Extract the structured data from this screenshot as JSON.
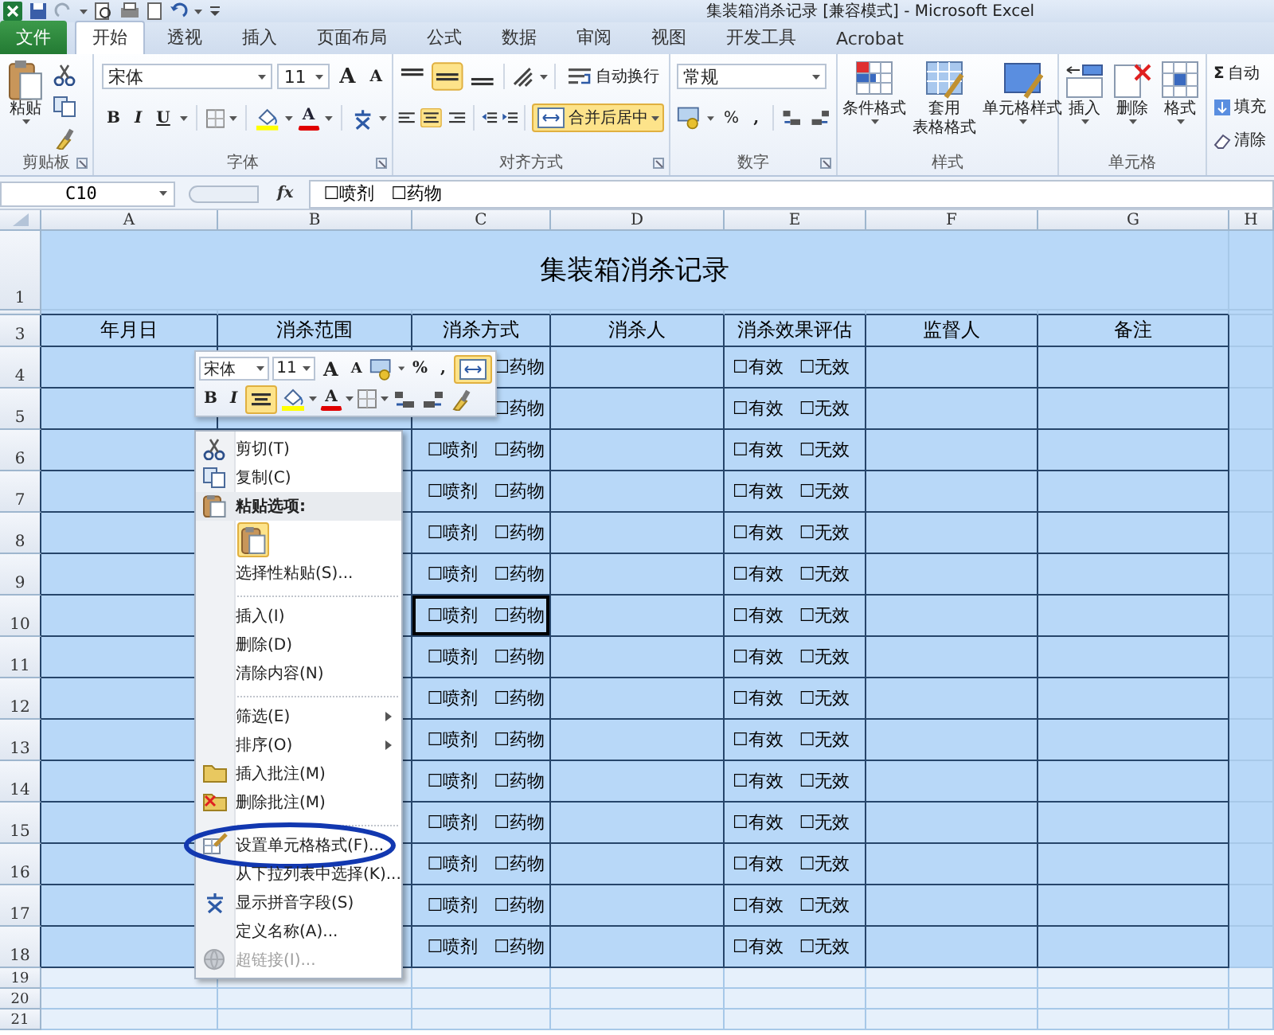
{
  "window": {
    "title": "集装箱消杀记录  [兼容模式] - Microsoft Excel"
  },
  "tabs": [
    {
      "label": "文件",
      "kind": "file",
      "selected": false
    },
    {
      "label": "开始",
      "kind": "tab",
      "selected": true
    },
    {
      "label": "透视",
      "kind": "tab",
      "selected": false
    },
    {
      "label": "插入",
      "kind": "tab",
      "selected": false
    },
    {
      "label": "页面布局",
      "kind": "tab",
      "selected": false
    },
    {
      "label": "公式",
      "kind": "tab",
      "selected": false
    },
    {
      "label": "数据",
      "kind": "tab",
      "selected": false
    },
    {
      "label": "审阅",
      "kind": "tab",
      "selected": false
    },
    {
      "label": "视图",
      "kind": "tab",
      "selected": false
    },
    {
      "label": "开发工具",
      "kind": "tab",
      "selected": false
    },
    {
      "label": "Acrobat",
      "kind": "tab",
      "selected": false
    }
  ],
  "ribbon": {
    "clipboard": {
      "label": "剪贴板",
      "paste": "粘贴"
    },
    "font": {
      "label": "字体",
      "name": "宋体",
      "size": "11",
      "grow": "A",
      "shrink": "A",
      "bold": "B",
      "italic": "I",
      "underline": "U",
      "color_letter": "A"
    },
    "alignment": {
      "label": "对齐方式",
      "vertical": [
        {
          "selected": false
        },
        {
          "selected": true
        },
        {
          "selected": false
        }
      ],
      "horizontal": [
        {
          "selected": false
        },
        {
          "selected": true
        },
        {
          "selected": false
        }
      ],
      "wrap": {
        "label": "自动换行",
        "on": false
      },
      "merge": {
        "label": "合并后居中",
        "on": true
      }
    },
    "number": {
      "label": "数字",
      "format": "常规",
      "percent": "%",
      "comma": ","
    },
    "styles": {
      "label": "样式",
      "conditional": "条件格式",
      "table": [
        "套用",
        "表格格式"
      ],
      "cell": "单元格样式"
    },
    "cells": {
      "label": "单元格",
      "insert": "插入",
      "delete": "删除",
      "format": "格式"
    },
    "editing": {
      "sigma": "Σ",
      "autosum": "自动",
      "fill": "填充",
      "clear": "清除"
    }
  },
  "formula_bar": {
    "name_box": "C10",
    "fx": "fx",
    "content": "☐喷剂   ☐药物"
  },
  "sheet": {
    "columns": [
      "A",
      "B",
      "C",
      "D",
      "E",
      "F",
      "G",
      "H"
    ],
    "title": {
      "row": "1",
      "text": "集装箱消杀记录"
    },
    "header_row": {
      "row": "3",
      "cells": [
        "年月日",
        "消杀范围",
        "消杀方式",
        "消杀人",
        "消杀效果评估",
        "监督人",
        "备注"
      ]
    },
    "rows": [
      {
        "row": "4",
        "method": [
          "☐药物"
        ],
        "evaluation": [
          "☐有效",
          "☐无效"
        ],
        "selected": false
      },
      {
        "row": "5",
        "method": [
          "☐药物"
        ],
        "evaluation": [
          "☐有效",
          "☐无效"
        ],
        "selected": false
      },
      {
        "row": "6",
        "method": [
          "☐喷剂",
          "☐药物"
        ],
        "evaluation": [
          "☐有效",
          "☐无效"
        ],
        "selected": false
      },
      {
        "row": "7",
        "method": [
          "☐喷剂",
          "☐药物"
        ],
        "evaluation": [
          "☐有效",
          "☐无效"
        ],
        "selected": false
      },
      {
        "row": "8",
        "method": [
          "☐喷剂",
          "☐药物"
        ],
        "evaluation": [
          "☐有效",
          "☐无效"
        ],
        "selected": false
      },
      {
        "row": "9",
        "method": [
          "☐喷剂",
          "☐药物"
        ],
        "evaluation": [
          "☐有效",
          "☐无效"
        ],
        "selected": false
      },
      {
        "row": "10",
        "method": [
          "☐喷剂",
          "☐药物"
        ],
        "evaluation": [
          "☐有效",
          "☐无效"
        ],
        "selected": true
      },
      {
        "row": "11",
        "method": [
          "☐喷剂",
          "☐药物"
        ],
        "evaluation": [
          "☐有效",
          "☐无效"
        ],
        "selected": false
      },
      {
        "row": "12",
        "method": [
          "☐喷剂",
          "☐药物"
        ],
        "evaluation": [
          "☐有效",
          "☐无效"
        ],
        "selected": false
      },
      {
        "row": "13",
        "method": [
          "☐喷剂",
          "☐药物"
        ],
        "evaluation": [
          "☐有效",
          "☐无效"
        ],
        "selected": false
      },
      {
        "row": "14",
        "method": [
          "☐喷剂",
          "☐药物"
        ],
        "evaluation": [
          "☐有效",
          "☐无效"
        ],
        "selected": false
      },
      {
        "row": "15",
        "method": [
          "☐喷剂",
          "☐药物"
        ],
        "evaluation": [
          "☐有效",
          "☐无效"
        ],
        "selected": false
      },
      {
        "row": "16",
        "method": [
          "☐喷剂",
          "☐药物"
        ],
        "evaluation": [
          "☐有效",
          "☐无效"
        ],
        "selected": false
      },
      {
        "row": "17",
        "method": [
          "☐喷剂",
          "☐药物"
        ],
        "evaluation": [
          "☐有效",
          "☐无效"
        ],
        "selected": false
      },
      {
        "row": "18",
        "method": [
          "☐喷剂",
          "☐药物"
        ],
        "evaluation": [
          "☐有效",
          "☐无效"
        ],
        "selected": false
      }
    ],
    "empty_rows": [
      "19",
      "20",
      "21"
    ]
  },
  "mini_toolbar": {
    "font": "宋体",
    "size": "11",
    "grow": "A",
    "shrink": "A",
    "percent": "%",
    "comma": ",",
    "merge_on": true,
    "bold": "B",
    "italic": "I",
    "center_on": true,
    "color_letter": "A"
  },
  "context_menu": {
    "items": [
      {
        "kind": "command",
        "label": "剪切(T)",
        "disabled": false,
        "circled": false
      },
      {
        "kind": "command",
        "label": "复制(C)",
        "disabled": false,
        "circled": false
      },
      {
        "kind": "header",
        "label": "粘贴选项:"
      },
      {
        "kind": "paste_options"
      },
      {
        "kind": "command",
        "label": "选择性粘贴(S)...",
        "disabled": false,
        "circled": false
      },
      {
        "kind": "separator"
      },
      {
        "kind": "command",
        "label": "插入(I)",
        "disabled": false,
        "circled": false
      },
      {
        "kind": "command",
        "label": "删除(D)",
        "disabled": false,
        "circled": false
      },
      {
        "kind": "command",
        "label": "清除内容(N)",
        "disabled": false,
        "circled": false
      },
      {
        "kind": "separator"
      },
      {
        "kind": "submenu",
        "label": "筛选(E)",
        "disabled": false,
        "circled": false
      },
      {
        "kind": "submenu",
        "label": "排序(O)",
        "disabled": false,
        "circled": false
      },
      {
        "kind": "command",
        "label": "插入批注(M)",
        "disabled": false,
        "circled": false
      },
      {
        "kind": "command",
        "label": "删除批注(M)",
        "disabled": false,
        "circled": false
      },
      {
        "kind": "separator"
      },
      {
        "kind": "command",
        "label": "设置单元格格式(F)...",
        "disabled": false,
        "circled": true
      },
      {
        "kind": "command",
        "label": "从下拉列表中选择(K)...",
        "disabled": false,
        "circled": false
      },
      {
        "kind": "command",
        "label": "显示拼音字段(S)",
        "disabled": false,
        "circled": false
      },
      {
        "kind": "command",
        "label": "定义名称(A)...",
        "disabled": false,
        "circled": false
      },
      {
        "kind": "command",
        "label": "超链接(I)...",
        "disabled": true,
        "circled": false
      }
    ]
  }
}
